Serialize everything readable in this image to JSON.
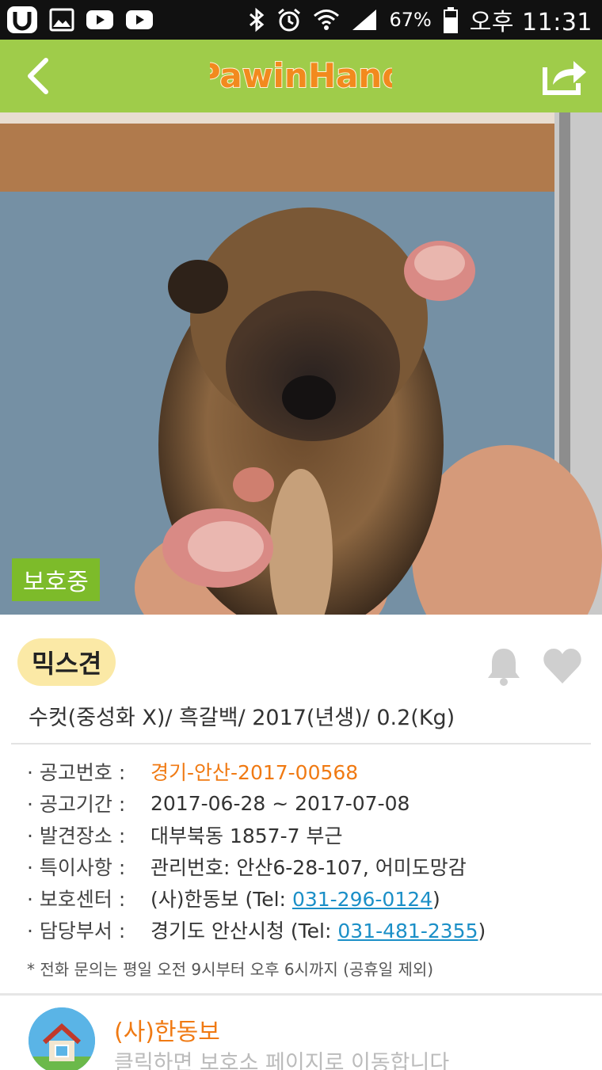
{
  "status_bar": {
    "battery_percent": "67%",
    "time": "오후 11:31",
    "left_icons": [
      "u-plus-icon",
      "image-icon",
      "youtube-icon",
      "youtube-icon"
    ],
    "right_icons": [
      "bluetooth-icon",
      "alarm-icon",
      "wifi-icon",
      "signal-icon",
      "battery-icon"
    ]
  },
  "app_bar": {
    "logo_text": "PawinHand",
    "bg_color": "#9fcc4a",
    "logo_color": "#f28a1e"
  },
  "hero": {
    "status_tag": "보호중",
    "tag_color": "#7dbb2a"
  },
  "animal": {
    "breed": "믹스견",
    "summary": "수컷(중성화 X)/ 흑갈백/ 2017(년생)/ 0.2(Kg)"
  },
  "details": {
    "rows": [
      {
        "label": "· 공고번호 :",
        "value": "경기-안산-2017-00568"
      },
      {
        "label": "· 공고기간 :",
        "value": "2017-06-28 ~ 2017-07-08"
      },
      {
        "label": "· 발견장소 :",
        "value": "대부북동 1857-7 부근"
      },
      {
        "label": "· 특이사항 :",
        "value": "관리번호: 안산6-28-107, 어미도망감"
      },
      {
        "label": "· 보호센터 :",
        "value_prefix": "(사)한동보 (Tel: ",
        "phone": "031-296-0124",
        "value_suffix": ")"
      },
      {
        "label": "· 담당부서 :",
        "value_prefix": "경기도 안산시청 (Tel: ",
        "phone": "031-481-2355",
        "value_suffix": ")"
      }
    ],
    "note": "* 전화 문의는 평일 오전 9시부터 오후 6시까지 (공휴일 제외)"
  },
  "shelter": {
    "name": "(사)한동보",
    "hint": "클릭하면 보호소 페이지로 이동합니다"
  }
}
